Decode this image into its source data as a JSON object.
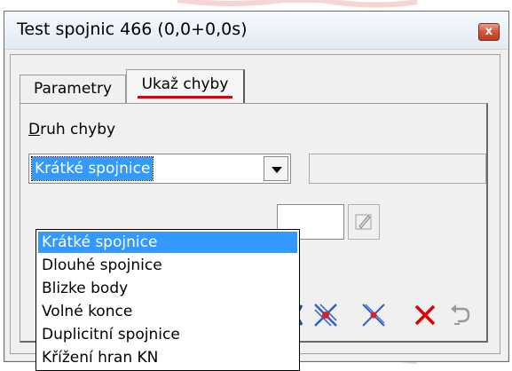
{
  "window": {
    "title": "Test spojnic 466 (0,0+0,0s)",
    "close_glyph": "x"
  },
  "tabs": [
    {
      "label": "Parametry",
      "active": false
    },
    {
      "label": "Ukaž chyby",
      "active": true
    }
  ],
  "error_type": {
    "label_underlined": "D",
    "label_rest": "ruh chyby",
    "selected": "Krátké spojnice",
    "options": [
      "Krátké spojnice",
      "Dlouhé spojnice",
      "Blizke body",
      "Volné konce",
      "Duplicitní spojnice",
      "Křížení hran KN"
    ]
  },
  "toolbar_icons": [
    "partial-cross-icon",
    "crossed-nodes-icon",
    "crossed-nodes-small-icon",
    "delete-x-icon",
    "undo-icon"
  ],
  "colors": {
    "selection": "#3399ff",
    "tab_underline": "#e0000a",
    "delete_icon": "#e00000",
    "close_button": "#c9432a"
  }
}
